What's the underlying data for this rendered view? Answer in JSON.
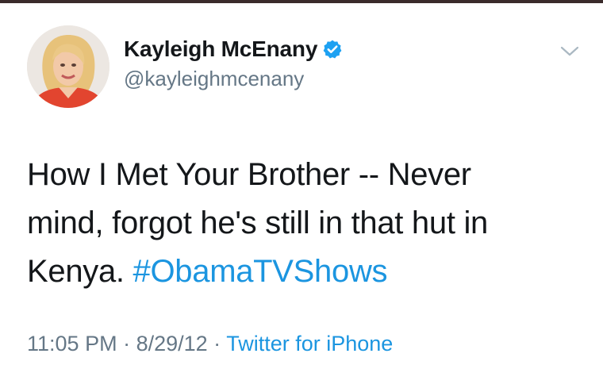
{
  "tweet": {
    "author": {
      "display_name": "Kayleigh McEnany",
      "handle": "@kayleighmcenany",
      "verified": true,
      "avatar_icon": "profile-photo"
    },
    "text_line_1": "How I Met Your Brother -- Never",
    "text_line_2": "mind, forgot he's still in that hut in",
    "text_line_3_plain": "Kenya. ",
    "hashtag": "#ObamaTVShows",
    "time": "11:05 PM",
    "separator": " · ",
    "date": "8/29/12",
    "source": "Twitter for iPhone",
    "menu_icon": "chevron-down-icon"
  },
  "colors": {
    "text": "#14171a",
    "secondary": "#657786",
    "link": "#1b95e0",
    "verified": "#1da1f2"
  }
}
